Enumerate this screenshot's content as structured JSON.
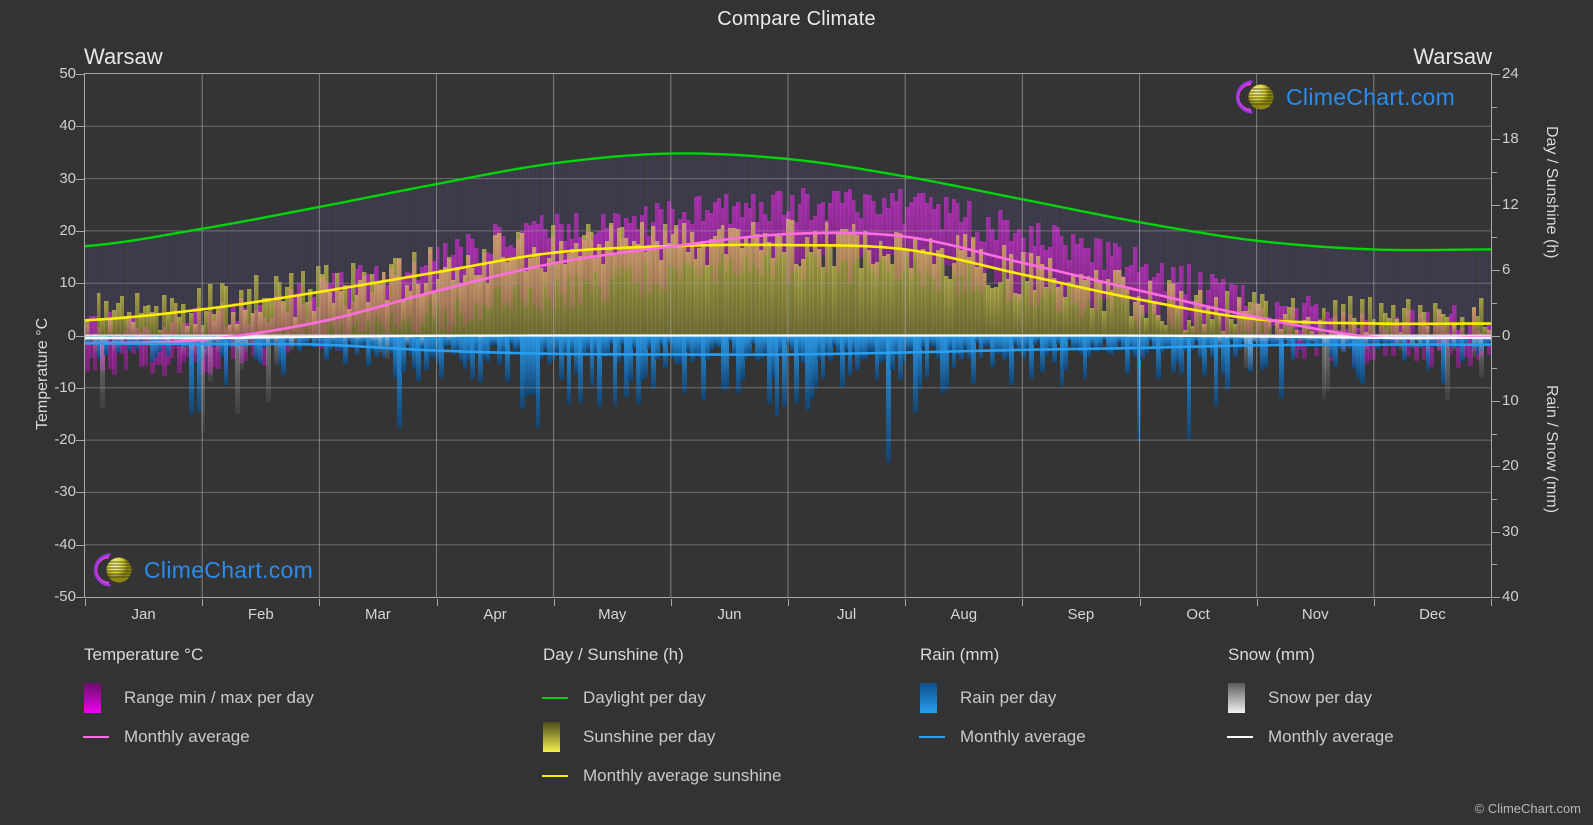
{
  "header": {
    "title": "Compare Climate",
    "location_left": "Warsaw",
    "location_right": "Warsaw"
  },
  "watermark": {
    "text": "ClimeChart.com",
    "copyright": "© ClimeChart.com",
    "brand_blue": "#2a8cf0",
    "ring_magenta": "#e23ae2",
    "sphere_yellow": "#e8e14a"
  },
  "axes": {
    "left": {
      "label": "Temperature °C",
      "ticks": [
        "50",
        "40",
        "30",
        "20",
        "10",
        "0",
        "-10",
        "-20",
        "-30",
        "-40",
        "-50"
      ],
      "min": -50,
      "max": 50
    },
    "right_top": {
      "label": "Day / Sunshine (h)",
      "ticks": [
        "24",
        "18",
        "12",
        "6",
        "0"
      ],
      "min": 0,
      "max": 24
    },
    "right_bottom": {
      "label": "Rain / Snow (mm)",
      "ticks": [
        "0",
        "10",
        "20",
        "30",
        "40"
      ],
      "min": 0,
      "max": 40
    },
    "x": {
      "ticks": [
        "Jan",
        "Feb",
        "Mar",
        "Apr",
        "May",
        "Jun",
        "Jul",
        "Aug",
        "Sep",
        "Oct",
        "Nov",
        "Dec"
      ]
    }
  },
  "legend": {
    "groups": [
      {
        "title": "Temperature °C",
        "items": [
          {
            "label": "Range min / max per day",
            "swatch": "box",
            "color": "#ef00ef",
            "color2": "#6b0f6b"
          },
          {
            "label": "Monthly average",
            "swatch": "line",
            "color": "#ff6ee0",
            "color2": "#ff6ee0"
          }
        ]
      },
      {
        "title": "Day / Sunshine (h)",
        "items": [
          {
            "label": "Daylight per day",
            "swatch": "line",
            "color": "#00d40a",
            "color2": "#00d40a"
          },
          {
            "label": "Sunshine per day",
            "swatch": "box",
            "color": "#f4f24c",
            "color2": "#4a4a1c"
          },
          {
            "label": "Monthly average sunshine",
            "swatch": "line",
            "color": "#ffee00",
            "color2": "#ffee00"
          }
        ]
      },
      {
        "title": "Rain (mm)",
        "items": [
          {
            "label": "Rain per day",
            "swatch": "box",
            "color": "#2a9ef0",
            "color2": "#0a4f8a"
          },
          {
            "label": "Monthly average",
            "swatch": "line",
            "color": "#2a9ef0",
            "color2": "#2a9ef0"
          }
        ]
      },
      {
        "title": "Snow (mm)",
        "items": [
          {
            "label": "Snow per day",
            "swatch": "box",
            "color": "#f2f2f2",
            "color2": "#5a5a5a"
          },
          {
            "label": "Monthly average",
            "swatch": "line",
            "color": "#ffffff",
            "color2": "#ffffff"
          }
        ]
      }
    ]
  },
  "chart_data": {
    "type": "line",
    "title": "Compare Climate",
    "subtitle": "Warsaw",
    "xlabel": "",
    "ylabel": "Temperature °C",
    "categories": [
      "Jan",
      "Feb",
      "Mar",
      "Apr",
      "May",
      "Jun",
      "Jul",
      "Aug",
      "Sep",
      "Oct",
      "Nov",
      "Dec"
    ],
    "ylim": [
      -50,
      50
    ],
    "ylim_right_top": [
      0,
      24
    ],
    "ylim_right_bottom": [
      0,
      40
    ],
    "grid": true,
    "legend_position": "below",
    "series": [
      {
        "name": "Monthly average temperature",
        "axis": "left",
        "unit": "°C",
        "color": "#ff6ee0",
        "values": [
          -1.5,
          -0.8,
          2.6,
          8.5,
          13.8,
          17.0,
          19.4,
          18.9,
          13.9,
          8.6,
          3.5,
          -0.3
        ]
      },
      {
        "name": "Monthly average sunshine",
        "axis": "right_top",
        "unit": "h",
        "color": "#ffee00",
        "values": [
          1.4,
          2.4,
          4.0,
          5.8,
          7.6,
          8.2,
          8.3,
          7.9,
          5.6,
          3.3,
          1.5,
          1.1
        ]
      },
      {
        "name": "Daylight per day",
        "axis": "right_top",
        "unit": "h",
        "color": "#00d40a",
        "values": [
          8.2,
          9.8,
          11.8,
          13.9,
          15.8,
          16.7,
          16.2,
          14.6,
          12.5,
          10.4,
          8.7,
          7.9
        ]
      },
      {
        "name": "Monthly average rain",
        "axis": "right_bottom",
        "unit": "mm",
        "color": "#2a9ef0",
        "values": [
          1.2,
          1.3,
          1.4,
          2.3,
          2.8,
          2.9,
          2.9,
          2.6,
          2.2,
          1.9,
          1.5,
          1.4
        ]
      },
      {
        "name": "Monthly average snow",
        "axis": "right_bottom",
        "unit": "mm",
        "color": "#ffffff",
        "values": [
          0.4,
          0.4,
          0.2,
          0.05,
          0.0,
          0.0,
          0.0,
          0.0,
          0.0,
          0.02,
          0.15,
          0.35
        ]
      },
      {
        "name": "Temperature range max per day",
        "axis": "left",
        "unit": "°C",
        "color": "#ef00ef",
        "values": [
          1.5,
          2.4,
          7.2,
          14.6,
          20.2,
          23.1,
          25.2,
          24.8,
          19.2,
          13.1,
          6.4,
          2.2
        ]
      },
      {
        "name": "Temperature range min per day",
        "axis": "left",
        "unit": "°C",
        "color": "#ef00ef",
        "values": [
          -4.5,
          -4.2,
          -1.2,
          3.2,
          7.8,
          11.2,
          13.4,
          12.8,
          8.8,
          4.4,
          0.6,
          -3.0
        ]
      }
    ]
  }
}
